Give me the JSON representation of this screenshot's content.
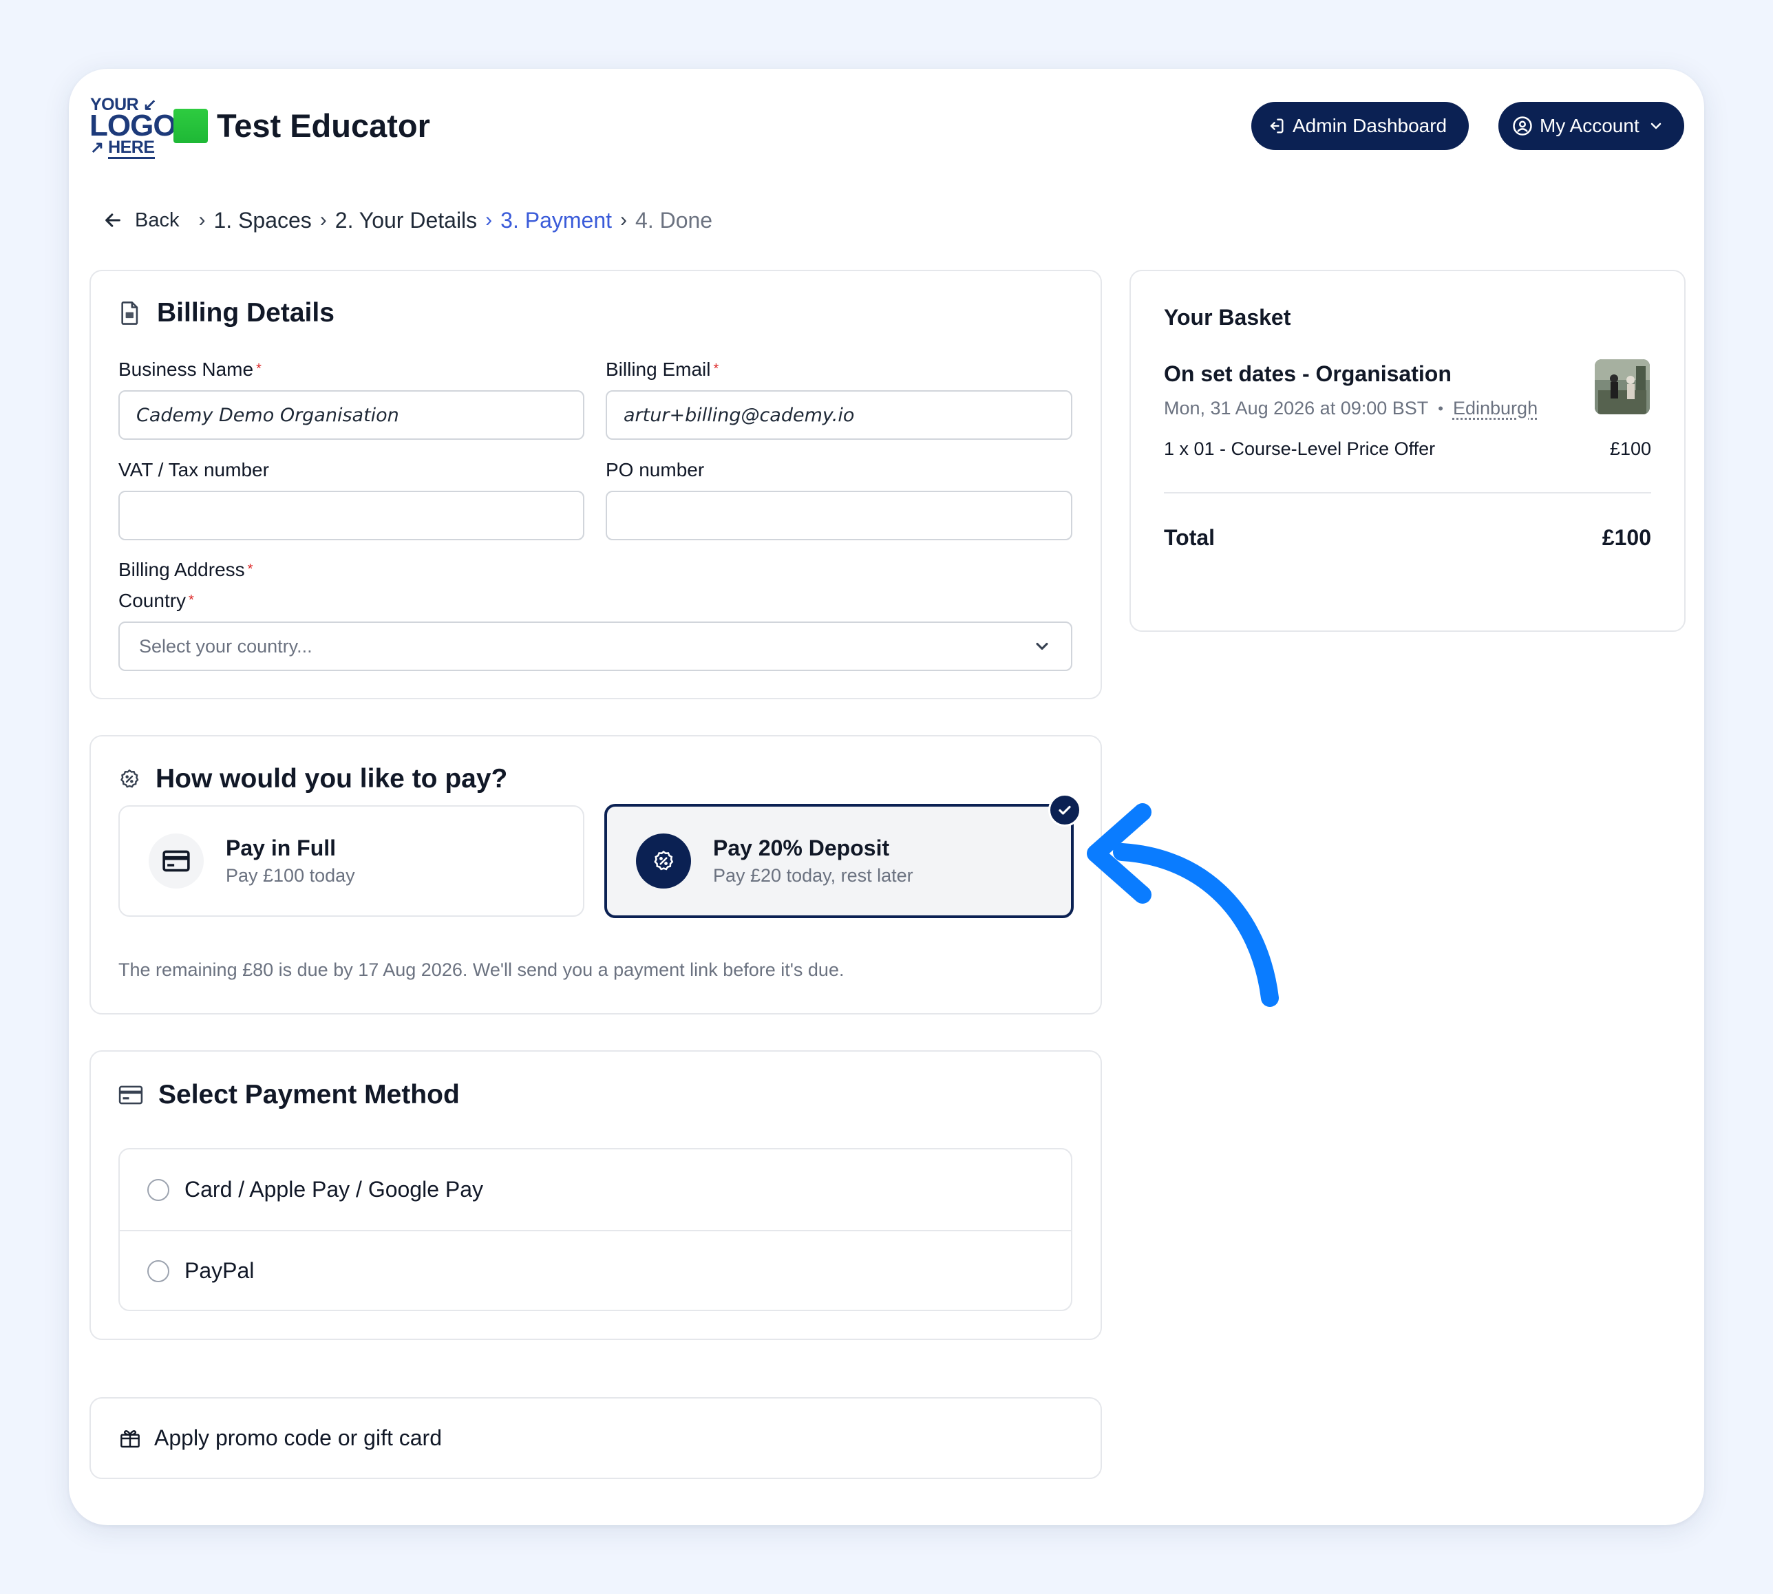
{
  "header": {
    "logo": {
      "line1": "YOUR",
      "line2": "LOGO",
      "line3": "HERE"
    },
    "site_title": "Test Educator",
    "admin_button": "Admin Dashboard",
    "account_button": "My Account"
  },
  "breadcrumb": {
    "back": "Back",
    "steps": [
      "1. Spaces",
      "2. Your Details",
      "3. Payment",
      "4. Done"
    ],
    "current_index": 2
  },
  "billing": {
    "title": "Billing Details",
    "business_name_label": "Business Name",
    "business_name_value": "Cademy Demo Organisation",
    "billing_email_label": "Billing Email",
    "billing_email_value": "artur+billing@cademy.io",
    "vat_label": "VAT / Tax number",
    "vat_value": "",
    "po_label": "PO number",
    "po_value": "",
    "address_label": "Billing Address",
    "country_label": "Country",
    "country_placeholder": "Select your country..."
  },
  "pay_choice": {
    "title": "How would you like to pay?",
    "full_title": "Pay in Full",
    "full_sub": "Pay £100 today",
    "deposit_title": "Pay 20% Deposit",
    "deposit_sub": "Pay £20 today, rest later",
    "selected": "deposit",
    "note": "The remaining £80 is due by 17 Aug 2026. We'll send you a payment link before it's due."
  },
  "payment_method": {
    "title": "Select Payment Method",
    "options": [
      "Card / Apple Pay / Google Pay",
      "PayPal"
    ]
  },
  "promo": {
    "label": "Apply promo code or gift card"
  },
  "basket": {
    "title": "Your Basket",
    "item_title": "On set dates - Organisation",
    "item_date": "Mon, 31 Aug 2026 at 09:00 BST",
    "item_location": "Edinburgh",
    "line_desc": "1 x 01 - Course-Level Price Offer",
    "line_price": "£100",
    "total_label": "Total",
    "total_value": "£100"
  },
  "colors": {
    "brand_navy": "#0b2153",
    "accent_blue": "#3a5bd9",
    "arrow_blue": "#0a7cff",
    "page_bg": "#f0f5fe"
  }
}
